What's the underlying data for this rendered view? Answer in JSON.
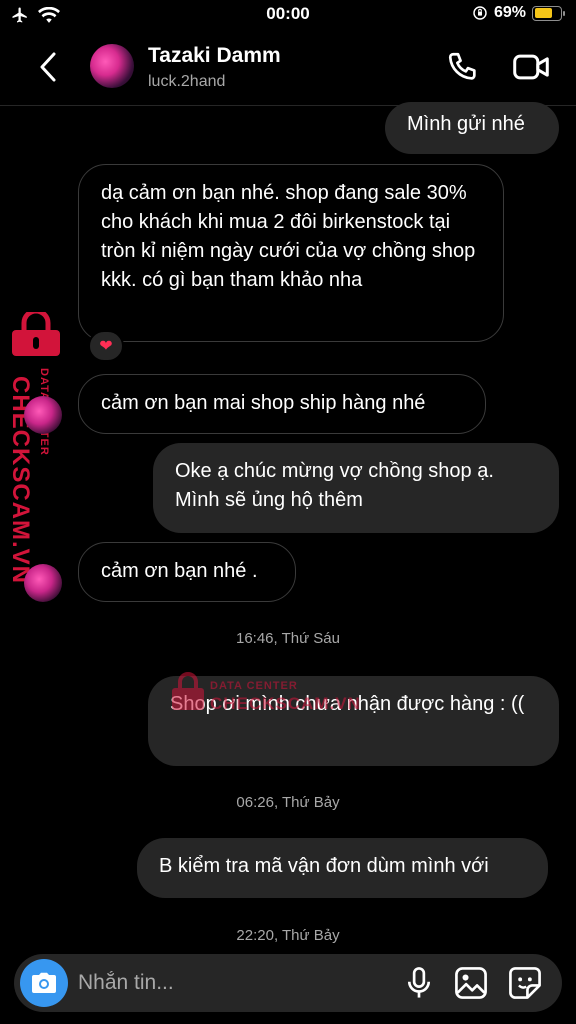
{
  "status_bar": {
    "time": "00:00",
    "battery": "69%",
    "battery_level": 0.69
  },
  "header": {
    "name": "Tazaki Damm",
    "username": "luck.2hand"
  },
  "messages": [
    {
      "from": "me",
      "text": "Mình gửi nhé"
    },
    {
      "from": "them",
      "text": "dạ cảm ơn bạn nhé. shop đang sale 30% cho khách khi mua 2 đôi birkenstock tại tròn kỉ niệm ngày cưới của vợ chồng shop kkk. có gì bạn tham khảo nha",
      "reaction": "❤"
    },
    {
      "from": "them",
      "text": "cảm ơn bạn mai shop ship hàng nhé"
    },
    {
      "from": "me",
      "text": "Oke ạ chúc mừng vợ chồng shop ạ. Mình sẽ ủng hộ thêm"
    },
    {
      "from": "them",
      "text": "cảm ơn bạn nhé ."
    },
    {
      "from": "me",
      "text": "Shop ơi mình chưa nhận được hàng : (("
    },
    {
      "from": "me",
      "text": "B kiểm tra mã vận đơn dùm mình với"
    }
  ],
  "timestamps": [
    "16:46, Thứ Sáu",
    "06:26, Thứ Bảy",
    "22:20, Thứ Bảy"
  ],
  "watermark": {
    "brand": "CHECKSCAM.VN",
    "sub": "DATA CENTER",
    "color": "#d2143a"
  },
  "composer": {
    "placeholder": "Nhắn tin..."
  },
  "colors": {
    "accent": "#3797f0",
    "outgoing_bubble": "#262626",
    "reaction": "#ff2e55"
  }
}
